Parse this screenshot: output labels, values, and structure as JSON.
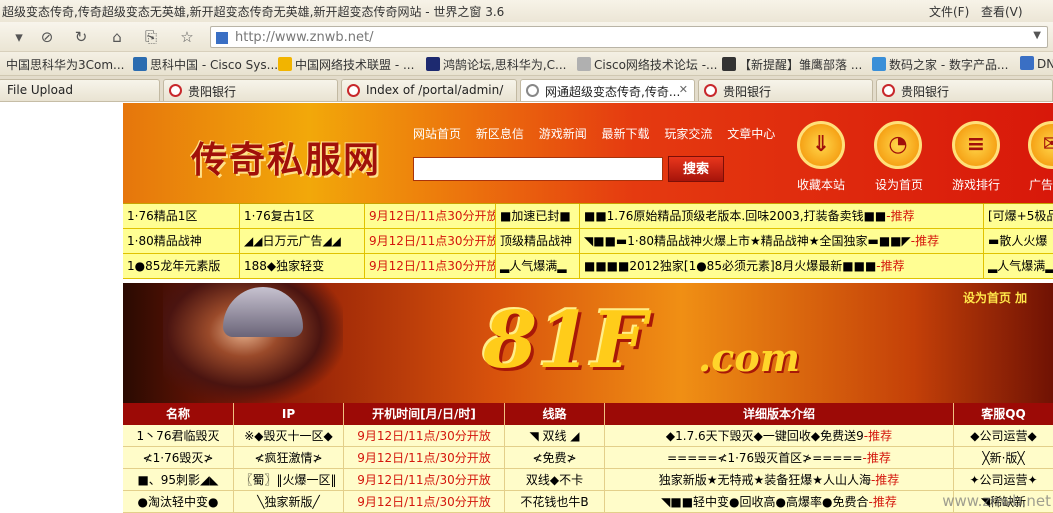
{
  "window": {
    "title": "超级变态传奇,传奇超级变态无英雄,新开超变态传奇无英雄,新开超变态传奇网站 - 世界之窗 3.6",
    "menu": [
      "文件(F)",
      "查看(V)"
    ]
  },
  "address": {
    "url": "http://www.znwb.net/"
  },
  "favorites": [
    "中国思科华为3Com...",
    "思科中国 - Cisco Sys...",
    "中国网络技术联盟 - ...",
    "鸿鹄论坛,思科华为,C...",
    "Cisco网络技术论坛 -...",
    "【新提醒】雏鹰部落 ...",
    "数码之家 - 数字产品...",
    "DN"
  ],
  "tabs": [
    {
      "label": "File Upload"
    },
    {
      "label": "贵阳银行"
    },
    {
      "label": "Index of /portal/admin/"
    },
    {
      "label": "网通超级变态传奇,传奇..."
    },
    {
      "label": "贵阳银行"
    },
    {
      "label": "贵阳银行"
    }
  ],
  "site": {
    "logo": "传奇私服网",
    "nav": [
      "网站首页",
      "新区息信",
      "游戏新闻",
      "最新下载",
      "玩家交流",
      "文章中心"
    ],
    "search_button": "搜索",
    "icons": [
      {
        "label": "收藏本站",
        "icon": "download-icon"
      },
      {
        "label": "设为首页",
        "icon": "chat-icon"
      },
      {
        "label": "游戏排行",
        "icon": "list-icon"
      },
      {
        "label": "广告",
        "icon": "ad-icon"
      }
    ],
    "grid": [
      [
        "1·76精品1区",
        "1·76复古1区",
        "9月12日/11点30分开放",
        "■加速已封■",
        "■■1.76原始精品顶级老版本.回味2003,打装备卖钱■■",
        "-推荐",
        "[可爆+5极品"
      ],
      [
        "1·80精品战神",
        "◢◢日万元广告◢◢",
        "9月12日/11点30分开放",
        "顶级精品战神",
        "◥■■▬1·80精品战神火爆上市★精品战神★全国独家▬■■◤",
        "-推荐",
        "▬散人火爆"
      ],
      [
        "1●85龙年元素版",
        "188◆独家轻变",
        "9月12日/11点30分开放",
        "▂人气爆满▂",
        "■■■■2012独家[1●85必须元素]8月火爆最新■■■",
        "-推荐",
        "▂人气爆满▂"
      ]
    ],
    "banner": {
      "big": "81F",
      "dotcom": ".com",
      "right_links": "设为首页   加"
    },
    "table": {
      "headers": [
        "名称",
        "IP",
        "开机时间[月/日/时]",
        "线路",
        "详细版本介绍",
        "客服QQ"
      ],
      "rows": [
        [
          "1丶76君临毁灭",
          "※◆毁灭十一区◆",
          "9月12日/11点/30分开放",
          "◥ 双线 ◢",
          "◆1.7.6天下毁灭◆一键回收◆免费送9",
          "-推荐",
          "◆公司运营◆"
        ],
        [
          "≮1·76毁灭≯",
          "≮疯狂激情≯",
          "9月12日/11点/30分开放",
          "≮免费≯",
          "=====≮1·76毁灭首区≯=====",
          "-推荐",
          "╳新·版╳"
        ],
        [
          "■、95刺影◢◣",
          "〖蜀〗‖火爆一区‖",
          "9月12日/11点/30分开放",
          "双线◆不卡",
          "独家新版★无特戒★装备狂爆★人山人海",
          "-推荐",
          "✦公司运营✦"
        ],
        [
          "●淘汰轻中变●",
          "╲独家新版╱",
          "9月12日/11点/30分开放",
          "不花钱也牛B",
          "◥■■轻中变●回收高●高爆率●免费合",
          "-推荐",
          "◥稀缺新"
        ]
      ]
    }
  },
  "watermark": "www.znwb.net"
}
